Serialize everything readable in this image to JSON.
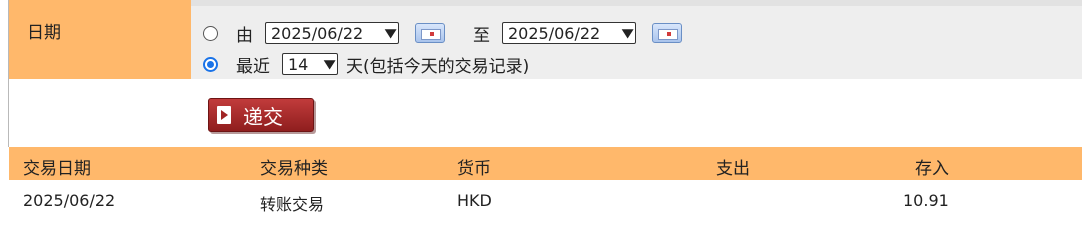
{
  "filter": {
    "date_label": "日期",
    "from_label": "由",
    "from_date": "2025/06/22",
    "to_label": "至",
    "to_date": "2025/06/22",
    "recent_label": "最近",
    "recent_days": "14",
    "recent_suffix": "天(包括今天的交易记录)",
    "selected_option": "recent"
  },
  "submit_label": "递交",
  "table": {
    "headers": [
      "交易日期",
      "交易种类",
      "货币",
      "支出",
      "存入"
    ],
    "rows": [
      {
        "date": "2025/06/22",
        "type": "转账交易",
        "currency": "HKD",
        "debit": "",
        "credit": "10.91"
      }
    ]
  },
  "colors": {
    "header_bg": "#ffb86b",
    "filter_bg": "#eeeeee",
    "button_bg": "#a12525",
    "radio_accent": "#1a73e8"
  }
}
